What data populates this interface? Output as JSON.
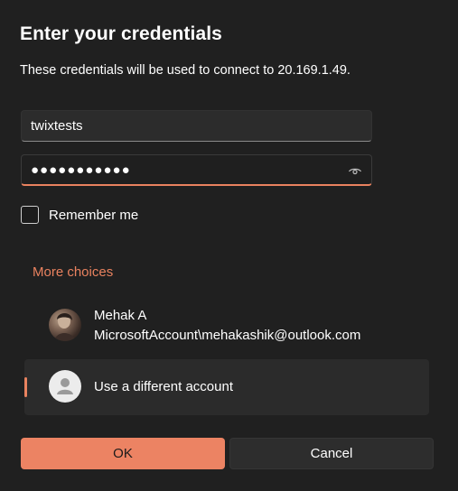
{
  "dialog": {
    "title": "Enter your credentials",
    "subtitle": "These credentials will be used to connect to 20.169.1.49."
  },
  "form": {
    "username_value": "twixtests",
    "password_value": "●●●●●●●●●●●",
    "remember_label": "Remember me",
    "remember_checked": false
  },
  "more_choices": {
    "label": "More choices",
    "accounts": [
      {
        "name": "Mehak A",
        "email": "MicrosoftAccount\\mehakashik@outlook.com",
        "avatar": "user-photo"
      }
    ],
    "different_account_label": "Use a different account"
  },
  "buttons": {
    "ok_label": "OK",
    "cancel_label": "Cancel"
  },
  "colors": {
    "accent": "#ec8363",
    "background": "#202020",
    "field_background": "#2c2c2c",
    "selected_item_background": "#2b2b2b"
  },
  "icons": {
    "reveal": "eye-icon",
    "avatar_generic": "person-icon"
  }
}
